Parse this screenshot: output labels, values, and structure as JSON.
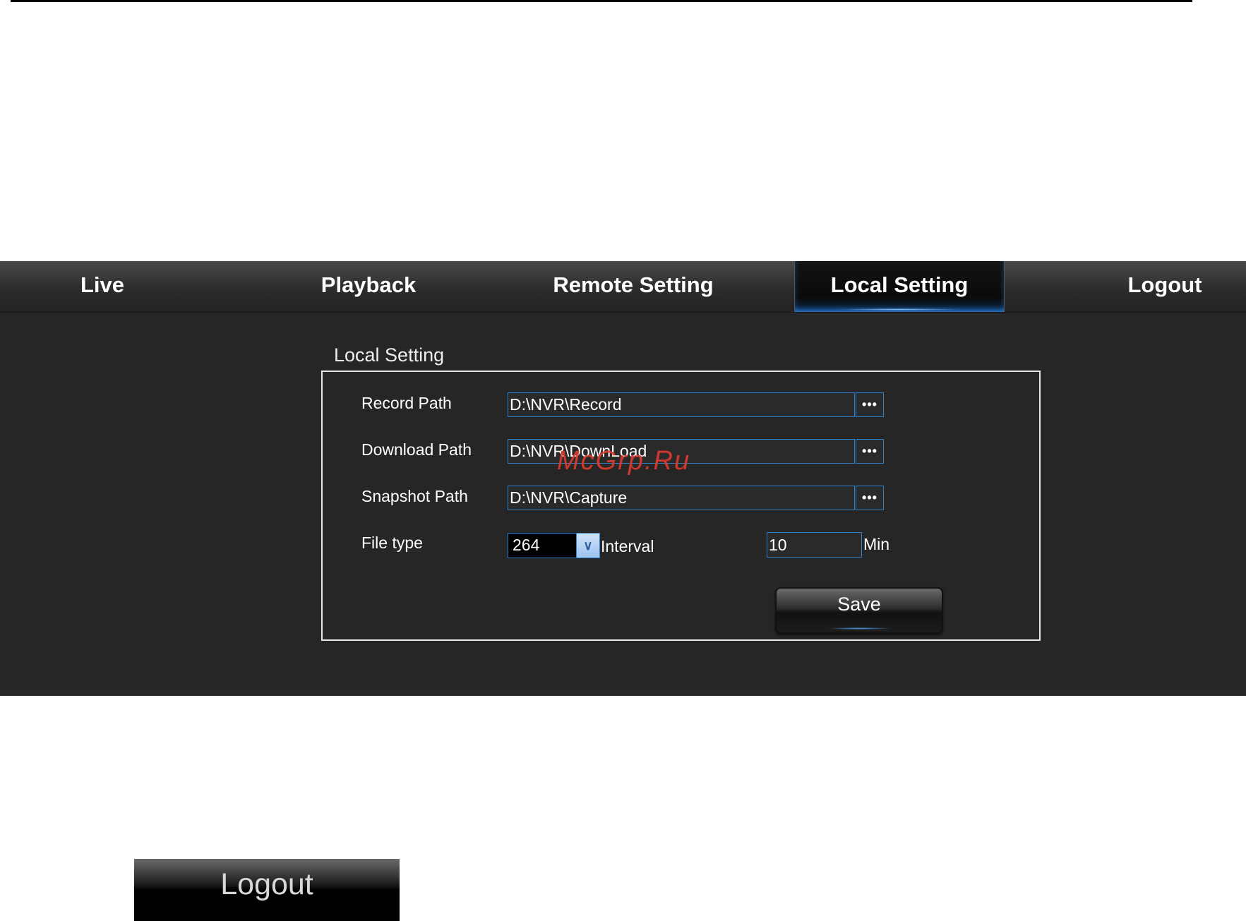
{
  "nav": {
    "items": [
      {
        "label": "Live"
      },
      {
        "label": "Playback"
      },
      {
        "label": "Remote Setting"
      },
      {
        "label": "Local Setting",
        "active": true
      },
      {
        "label": "Logout"
      }
    ]
  },
  "local_setting": {
    "title": "Local Setting",
    "record_path": {
      "label": "Record Path",
      "value": "D:\\NVR\\Record",
      "browse_label": "•••"
    },
    "download_path": {
      "label": "Download Path",
      "value": "D:\\NVR\\DownLoad",
      "browse_label": "•••"
    },
    "snapshot_path": {
      "label": "Snapshot Path",
      "value": "D:\\NVR\\Capture",
      "browse_label": "•••"
    },
    "file_type": {
      "label": "File type",
      "selected": "264"
    },
    "interval": {
      "label": "Interval",
      "value": "10",
      "unit": "Min"
    },
    "save_label": "Save"
  },
  "watermark": "McGrp.Ru",
  "logout_sample": {
    "label": "Logout"
  },
  "colors": {
    "accent": "#2f7fc4",
    "panel_bg": "#262626",
    "watermark": "#e03a2e"
  }
}
